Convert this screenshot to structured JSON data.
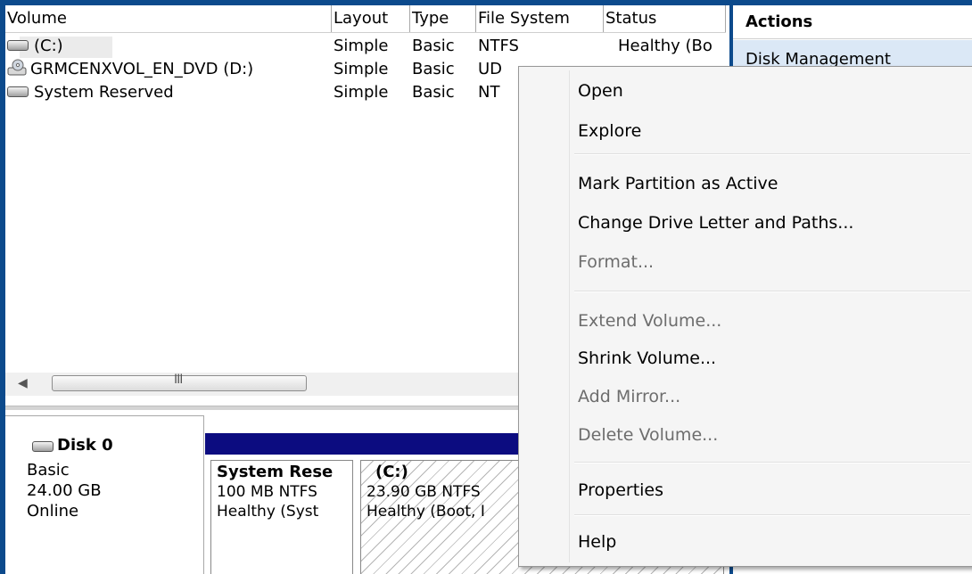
{
  "columns": {
    "volume": "Volume",
    "layout": "Layout",
    "type": "Type",
    "file_system": "File System",
    "status": "Status"
  },
  "volumes": [
    {
      "name": "(C:)",
      "layout": "Simple",
      "type": "Basic",
      "fs": "NTFS",
      "status": "Healthy (Bo"
    },
    {
      "name": "GRMCENXVOL_EN_DVD (D:)",
      "layout": "Simple",
      "type": "Basic",
      "fs": "UD",
      "status": ""
    },
    {
      "name": "System Reserved",
      "layout": "Simple",
      "type": "Basic",
      "fs": "NT",
      "status": ""
    }
  ],
  "scrollbar": {
    "grip": "III"
  },
  "disk": {
    "title": "Disk 0",
    "type": "Basic",
    "size": "24.00 GB",
    "state": "Online"
  },
  "partitions": [
    {
      "name": "System Rese",
      "detail": "100 MB NTFS",
      "status": "Healthy (Syst"
    },
    {
      "name": "(C:)",
      "detail": "23.90 GB NTFS",
      "status": "Healthy (Boot, I"
    }
  ],
  "actions": {
    "title": "Actions",
    "subtitle": "Disk Management"
  },
  "context_menu": {
    "items": [
      {
        "label": "Open",
        "enabled": true
      },
      {
        "label": "Explore",
        "enabled": true
      },
      {
        "label": "Mark Partition as Active",
        "enabled": true
      },
      {
        "label": "Change Drive Letter and Paths...",
        "enabled": true
      },
      {
        "label": "Format...",
        "enabled": false
      },
      {
        "label": "Extend Volume...",
        "enabled": false
      },
      {
        "label": "Shrink Volume...",
        "enabled": true
      },
      {
        "label": "Add Mirror...",
        "enabled": false
      },
      {
        "label": "Delete Volume...",
        "enabled": false
      },
      {
        "label": "Properties",
        "enabled": true
      },
      {
        "label": "Help",
        "enabled": true
      }
    ]
  },
  "colors": {
    "frame": "#0c4a8c",
    "partition_bar": "#0c0c80",
    "actions_highlight": "#dbe8f6"
  }
}
